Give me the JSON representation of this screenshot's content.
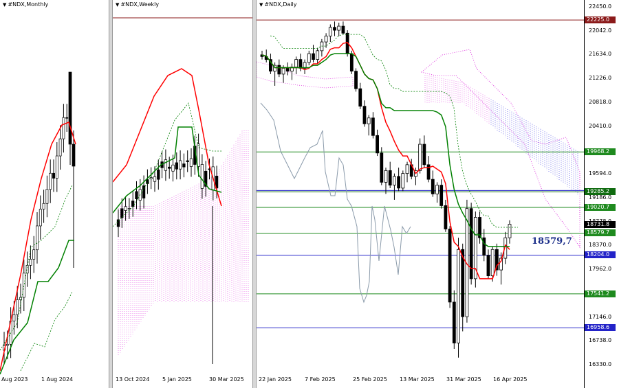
{
  "panels": [
    {
      "title": "#NDX,Monthly",
      "x_labels": [
        "Aug 2023",
        "1 Aug 2024"
      ]
    },
    {
      "title": "#NDX,Weekly",
      "x_labels": [
        "13 Oct 2024",
        "5 Jan 2025",
        "30 Mar 2025"
      ]
    },
    {
      "title": "#NDX,Daily",
      "x_labels": [
        "22 Jan 2025",
        "7 Feb 2025",
        "25 Feb 2025",
        "13 Mar 2025",
        "31 Mar 2025",
        "16 Apr 2025"
      ]
    }
  ],
  "price_axis": {
    "ticks": [
      "22450.0",
      "22042.0",
      "21634.0",
      "21226.0",
      "20818.0",
      "20410.0",
      "19594.0",
      "19186.0",
      "18778.0",
      "18370.0",
      "17962.0",
      "17146.0",
      "16738.0",
      "16330.0"
    ]
  },
  "level_tags": [
    {
      "text": "22225.0",
      "bg": "#8b1a1a",
      "fg": "#ffffff"
    },
    {
      "text": "19968.2",
      "bg": "#1e8a1e",
      "fg": "#ffffff"
    },
    {
      "text": "19285.2",
      "bg": "#0f6b0f",
      "fg": "#ffffff"
    },
    {
      "text": "19020.7",
      "bg": "#1e8a1e",
      "fg": "#ffffff"
    },
    {
      "text": "18731.8",
      "bg": "#000000",
      "fg": "#ffffff"
    },
    {
      "text": "18579.7",
      "bg": "#1e8a1e",
      "fg": "#ffffff"
    },
    {
      "text": "18204.0",
      "bg": "#2323c8",
      "fg": "#ffffff"
    },
    {
      "text": "17541.2",
      "bg": "#1e8a1e",
      "fg": "#ffffff"
    },
    {
      "text": "16958.6",
      "bg": "#2323c8",
      "fg": "#ffffff"
    }
  ],
  "annotation": "18579,7",
  "colors": {
    "tenkan": "#ff0000",
    "kijun": "#008000",
    "chikou": "#8a9aaa",
    "cloud_bear": "#e040e0",
    "cloud_bull": "#3030e0",
    "level_green": "#1e8a1e",
    "level_blue": "#2323c8",
    "level_red": "#8b1a1a"
  },
  "chart_data": [
    {
      "type": "candlestick",
      "title": "#NDX,Monthly",
      "x_tick_labels": [
        "Aug 2023",
        "1 Aug 2024"
      ],
      "indicators": [
        "Ichimoku Tenkan-sen (red)",
        "Ichimoku Kijun-sen (green)",
        "Senkou levels (green dashed)"
      ]
    },
    {
      "type": "candlestick",
      "title": "#NDX,Weekly",
      "x_tick_labels": [
        "13 Oct 2024",
        "5 Jan 2025",
        "30 Mar 2025"
      ],
      "indicators": [
        "Tenkan-sen (red)",
        "Kijun-sen (green)",
        "Ichimoku cloud (magenta dotted)"
      ]
    },
    {
      "type": "candlestick",
      "title": "#NDX,Daily",
      "x_tick_labels": [
        "22 Jan 2025",
        "7 Feb 2025",
        "25 Feb 2025",
        "13 Mar 2025",
        "31 Mar 2025",
        "16 Apr 2025"
      ],
      "ylim": [
        16150,
        22600
      ],
      "y_ticks": [
        22450.0,
        22042.0,
        21634.0,
        21226.0,
        20818.0,
        20410.0,
        19594.0,
        19186.0,
        18778.0,
        18370.0,
        17962.0,
        17146.0,
        16738.0,
        16330.0
      ],
      "horizontal_levels": [
        {
          "value": 22225.0,
          "color": "#8b1a1a"
        },
        {
          "value": 19968.2,
          "color": "#1e8a1e"
        },
        {
          "value": 19285.2,
          "color": "#0f6b0f"
        },
        {
          "value": 19020.7,
          "color": "#1e8a1e"
        },
        {
          "value": 18579.7,
          "color": "#1e8a1e"
        },
        {
          "value": 18204.0,
          "color": "#2323c8"
        },
        {
          "value": 17541.2,
          "color": "#1e8a1e"
        },
        {
          "value": 16958.6,
          "color": "#2323c8"
        }
      ],
      "last_price": 18731.8,
      "annotation": "18579,7",
      "candles_ohlc": [
        [
          21630,
          21700,
          21550,
          21600
        ],
        [
          21600,
          21720,
          21500,
          21550
        ],
        [
          21550,
          21650,
          21300,
          21350
        ],
        [
          21350,
          21500,
          21100,
          21450
        ],
        [
          21450,
          21550,
          21250,
          21300
        ],
        [
          21300,
          21450,
          21150,
          21400
        ],
        [
          21400,
          21500,
          21280,
          21350
        ],
        [
          21350,
          21480,
          21200,
          21420
        ],
        [
          21420,
          21600,
          21300,
          21550
        ],
        [
          21550,
          21650,
          21350,
          21400
        ],
        [
          21400,
          21550,
          21300,
          21500
        ],
        [
          21500,
          21700,
          21450,
          21650
        ],
        [
          21650,
          21800,
          21500,
          21550
        ],
        [
          21550,
          21750,
          21480,
          21700
        ],
        [
          21700,
          21900,
          21600,
          21850
        ],
        [
          21850,
          22000,
          21750,
          21950
        ],
        [
          21950,
          22150,
          21850,
          22100
        ],
        [
          22100,
          22200,
          21950,
          22050
        ],
        [
          22050,
          22180,
          21950,
          22120
        ],
        [
          22120,
          22200,
          21980,
          22000
        ],
        [
          22000,
          22050,
          21600,
          21650
        ],
        [
          21650,
          21700,
          21300,
          21350
        ],
        [
          21350,
          21400,
          21000,
          21050
        ],
        [
          21050,
          21150,
          20700,
          20750
        ],
        [
          20750,
          20850,
          20400,
          20450
        ],
        [
          20450,
          20600,
          20250,
          20550
        ],
        [
          20550,
          20650,
          20200,
          20250
        ],
        [
          20250,
          20350,
          19900,
          19950
        ],
        [
          19950,
          20050,
          19400,
          19450
        ],
        [
          19450,
          19700,
          19250,
          19650
        ],
        [
          19650,
          19800,
          19350,
          19400
        ],
        [
          19400,
          19600,
          19150,
          19550
        ],
        [
          19550,
          19700,
          19300,
          19350
        ],
        [
          19350,
          19650,
          19300,
          19600
        ],
        [
          19600,
          19800,
          19450,
          19750
        ],
        [
          19750,
          19850,
          19500,
          19550
        ],
        [
          19550,
          19700,
          19400,
          19650
        ],
        [
          19650,
          20200,
          19600,
          20100
        ],
        [
          20100,
          20250,
          19700,
          19750
        ],
        [
          19750,
          19900,
          19450,
          19500
        ],
        [
          19500,
          19650,
          19200,
          19250
        ],
        [
          19250,
          19450,
          19100,
          19400
        ],
        [
          19400,
          19500,
          19000,
          19050
        ],
        [
          19050,
          19150,
          18600,
          18650
        ],
        [
          18650,
          18700,
          17300,
          17400
        ],
        [
          17400,
          17600,
          16600,
          16700
        ],
        [
          16700,
          18500,
          16450,
          18300
        ],
        [
          18300,
          18400,
          16900,
          17150
        ],
        [
          17150,
          19150,
          17050,
          19000
        ],
        [
          19000,
          19100,
          17700,
          17800
        ],
        [
          17800,
          18950,
          17650,
          18850
        ],
        [
          18850,
          18950,
          18400,
          18500
        ],
        [
          18500,
          18650,
          18100,
          18200
        ],
        [
          18200,
          18300,
          17800,
          17850
        ],
        [
          17850,
          18350,
          17750,
          18300
        ],
        [
          18300,
          18400,
          17850,
          17950
        ],
        [
          17950,
          18250,
          17700,
          18150
        ],
        [
          18150,
          18600,
          18050,
          18500
        ],
        [
          18500,
          18800,
          18400,
          18732
        ]
      ]
    }
  ]
}
